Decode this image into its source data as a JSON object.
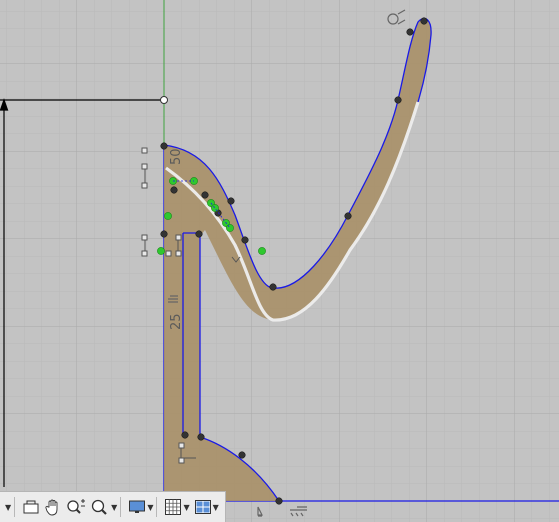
{
  "sketch": {
    "dimensions": [
      {
        "id": "dim-50",
        "label": "50"
      },
      {
        "id": "dim-25",
        "label": "25"
      }
    ],
    "colors": {
      "grid_minor": "#b8b8b8",
      "grid_major": "#a9a9a9",
      "profile_fill": "#a89068",
      "profile_line": "#1a1ae6",
      "control_point": "#2ec82e",
      "y_axis": "#3fa33f",
      "offset_curve": "#eeeeee"
    }
  },
  "nav_toolbar": {
    "buttons": [
      {
        "name": "orbit-button",
        "icon": "orbit-icon",
        "has_dropdown": true
      },
      {
        "name": "look-at-button",
        "icon": "look-at-icon",
        "has_dropdown": false
      },
      {
        "name": "pan-button",
        "icon": "hand-icon",
        "has_dropdown": false
      },
      {
        "name": "zoom-button",
        "icon": "zoom-plus-minus-icon",
        "has_dropdown": false
      },
      {
        "name": "fit-button",
        "icon": "zoom-window-icon",
        "has_dropdown": true
      },
      {
        "name": "display-settings-button",
        "icon": "monitor-icon",
        "has_dropdown": true
      },
      {
        "name": "grid-snap-button",
        "icon": "grid-icon",
        "has_dropdown": true
      },
      {
        "name": "viewports-button",
        "icon": "viewports-icon",
        "has_dropdown": true
      }
    ]
  }
}
